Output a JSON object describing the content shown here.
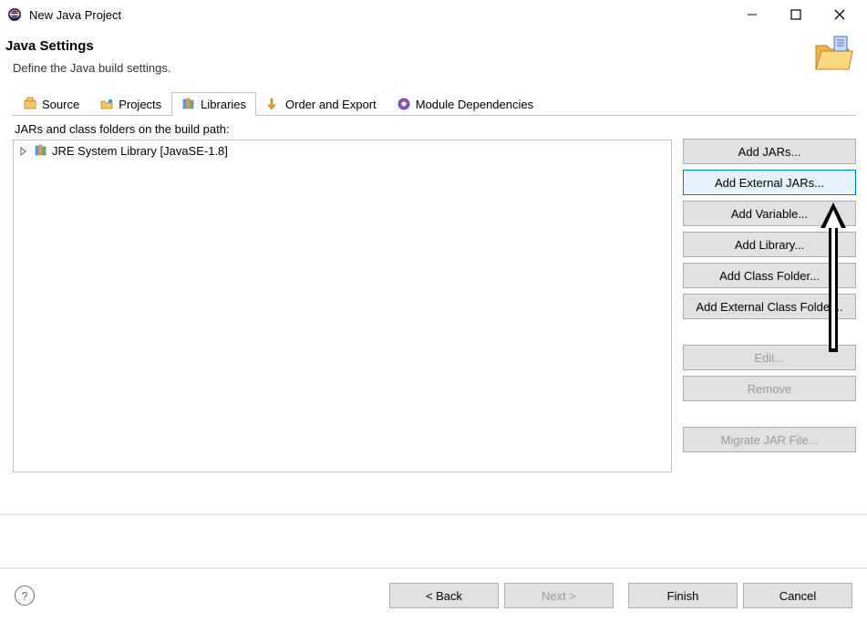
{
  "window": {
    "title": "New Java Project"
  },
  "header": {
    "title": "Java Settings",
    "subtitle": "Define the Java build settings."
  },
  "tabs": {
    "items": [
      {
        "label": "Source"
      },
      {
        "label": "Projects"
      },
      {
        "label": "Libraries"
      },
      {
        "label": "Order and Export"
      },
      {
        "label": "Module Dependencies"
      }
    ],
    "activeIndex": 2
  },
  "tree": {
    "label": "JARs and class folders on the build path:",
    "items": [
      {
        "label": "JRE System Library [JavaSE-1.8]"
      }
    ]
  },
  "sideButtons": {
    "addJars": "Add JARs...",
    "addExternalJars": "Add External JARs...",
    "addVariable": "Add Variable...",
    "addLibrary": "Add Library...",
    "addClassFolder": "Add Class Folder...",
    "addExternalClassFolder": "Add External Class Folder...",
    "edit": "Edit...",
    "remove": "Remove",
    "migrate": "Migrate JAR File..."
  },
  "footer": {
    "back": "< Back",
    "next": "Next >",
    "finish": "Finish",
    "cancel": "Cancel"
  }
}
